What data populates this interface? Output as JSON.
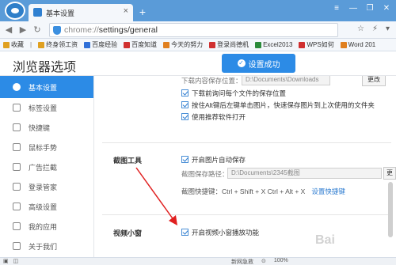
{
  "browser": {
    "tab_title": "基本设置",
    "tab_close": "×",
    "new_tab": "+",
    "win_controls": [
      "≡",
      "—",
      "❐",
      "✕"
    ],
    "url_scheme": "chrome://",
    "url_path": "settings/general",
    "nav": {
      "back": "◀",
      "forward": "▶",
      "refresh": "↻"
    },
    "addr_right": [
      "☆",
      "⚡",
      "▾"
    ]
  },
  "bookmarks": {
    "label": "收藏",
    "items": [
      {
        "label": "终身领工资",
        "color": "#e0a020"
      },
      {
        "label": "百度经验",
        "color": "#3070d8"
      },
      {
        "label": "百度知道",
        "color": "#d03030"
      },
      {
        "label": "今天的努力",
        "color": "#e08020"
      },
      {
        "label": "登录尚德机",
        "color": "#d03030"
      },
      {
        "label": "Excel2013",
        "color": "#2a8a3a"
      },
      {
        "label": "WPS如何",
        "color": "#d03030"
      },
      {
        "label": "Word 201",
        "color": "#e08020"
      }
    ]
  },
  "page": {
    "title": "浏览器选项",
    "success_label": "设置成功",
    "success_icon": "✓"
  },
  "sidebar": {
    "items": [
      {
        "label": "基本设置",
        "icon": "gear-icon",
        "active": true
      },
      {
        "label": "标签设置",
        "icon": "tab-icon",
        "active": false
      },
      {
        "label": "快捷键",
        "icon": "keyboard-icon",
        "active": false
      },
      {
        "label": "鼠标手势",
        "icon": "mouse-icon",
        "active": false
      },
      {
        "label": "广告拦截",
        "icon": "block-icon",
        "active": false
      },
      {
        "label": "登录管家",
        "icon": "lock-icon",
        "active": false
      },
      {
        "label": "高级设置",
        "icon": "settings-icon",
        "active": false
      },
      {
        "label": "我的应用",
        "icon": "apps-icon",
        "active": false
      },
      {
        "label": "关于我们",
        "icon": "info-icon",
        "active": false
      }
    ]
  },
  "content": {
    "download_path_label": "下载内容保存位置：",
    "download_path_value": "D:\\Documents\\Downloads",
    "change_label": "更改",
    "opt_ask_each": "下载前询问每个文件的保存位置",
    "opt_alt_click": "按住Alt键后左键单击图片，快速保存图片到上次使用的文件夹",
    "opt_recommended": "使用推荐软件打开",
    "screenshot_section": "截图工具",
    "opt_auto_save": "开启图片自动保存",
    "screenshot_path_label": "截图保存路径：",
    "screenshot_path_value": "D:\\Documents\\2345截图",
    "change_label_2": "更",
    "shortcut_label": "截图快捷键：Ctrl + Shift + X  Ctrl + Alt + X",
    "shortcut_link": "设置快捷键",
    "video_section": "视频小窗",
    "opt_video_small": "开启视频小窗播放功能"
  },
  "status": {
    "left": [
      "▣",
      "◫"
    ],
    "right": [
      "新网急救",
      "⊙",
      "100%"
    ]
  },
  "watermark": "Bai"
}
